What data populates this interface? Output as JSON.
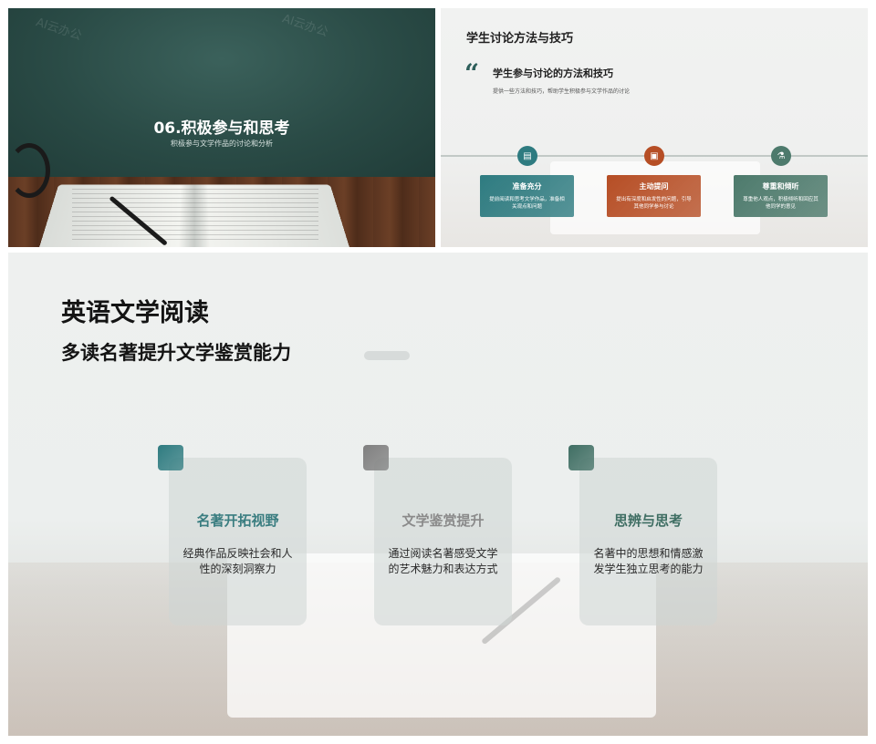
{
  "slide1": {
    "watermark": "AI云办公",
    "title": "06.积极参与和思考",
    "subtitle": "积极参与文学作品的讨论和分析"
  },
  "slide2": {
    "title": "学生讨论方法与技巧",
    "quote_mark": "“",
    "heading": "学生参与讨论的方法和技巧",
    "desc": "提供一些方法和技巧，帮助学生积极参与文学作品的讨论",
    "cards": [
      {
        "icon": "document-icon",
        "glyph": "▤",
        "title": "准备充分",
        "desc": "提前阅读和思考文学作品，准备相关观点和问题",
        "color": "#2e7b80"
      },
      {
        "icon": "image-icon",
        "glyph": "▣",
        "title": "主动提问",
        "desc": "提出有深度和启发性的问题，引导其他同学参与讨论",
        "color": "#b64e25"
      },
      {
        "icon": "flask-icon",
        "glyph": "⚗",
        "title": "尊重和倾听",
        "desc": "尊重他人观点，积极倾听和回应其他同学的意见",
        "color": "#4d7a6c"
      }
    ]
  },
  "slide3": {
    "title": "英语文学阅读",
    "subtitle": "多读名著提升文学鉴赏能力",
    "features": [
      {
        "title": "名著开拓视野",
        "desc": "经典作品反映社会和人性的深刻洞察力",
        "color": "#2e7b80",
        "title_color": "#3a7d80"
      },
      {
        "title": "文学鉴赏提升",
        "desc": "通过阅读名著感受文学的艺术魅力和表达方式",
        "color": "#7f7f7f",
        "title_color": "#8a8a8a"
      },
      {
        "title": "思辨与思考",
        "desc": "名著中的思想和情感激发学生独立思考的能力",
        "color": "#3f6e63",
        "title_color": "#3f6e63"
      }
    ]
  }
}
